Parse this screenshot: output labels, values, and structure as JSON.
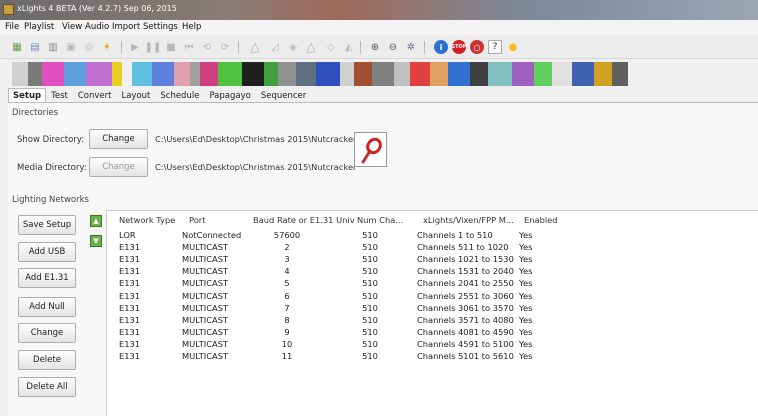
{
  "window": {
    "title": "xLights 4 BETA (Ver 4.2.7) Sep 06, 2015"
  },
  "menu": [
    "File",
    "Playlist",
    "View",
    "Audio",
    "Import",
    "Settings",
    "Help"
  ],
  "toolbar_icons": [
    "new-icon",
    "save-icon",
    "open-icon",
    "render-icon",
    "undo-icon",
    "refresh-icon",
    "play-icon",
    "pause-icon",
    "stop-icon",
    "first-frame-icon",
    "replay-icon",
    "triangle-icon",
    "ramp-icon",
    "cube-icon",
    "triangle-outline-icon",
    "diamond-icon",
    "zoom-in-icon",
    "zoom-out-icon",
    "settings-icon",
    "info-icon",
    "stop-sign-icon",
    "lights-off-icon",
    "help-icon",
    "bulb-icon"
  ],
  "tabs": [
    "Setup",
    "Test",
    "Convert",
    "Layout",
    "Schedule",
    "Papagayo",
    "Sequencer"
  ],
  "active_tab": "Setup",
  "directories": {
    "section_label": "Directories",
    "show_label": "Show Directory:",
    "show_button": "Change",
    "show_path": "C:\\Users\\Ed\\Desktop\\Christmas 2015\\Nutcracker",
    "media_label": "Media Directory:",
    "media_button": "Change",
    "media_path": "C:\\Users\\Ed\\Desktop\\Christmas 2015\\Nutcracker"
  },
  "networks": {
    "section_label": "Lighting Networks",
    "buttons": [
      "Save Setup",
      "Add USB",
      "Add E1.31",
      "Add Null",
      "Change",
      "Delete",
      "Delete All"
    ],
    "columns": [
      "Network Type",
      "Port",
      "Baud Rate or E1.31 Univ",
      "Num Cha...",
      "xLights/Vixen/FPP M...",
      "Enabled"
    ],
    "rows": [
      [
        "LOR",
        "NotConnected",
        "57600",
        "510",
        "Channels 1 to 510",
        "Yes"
      ],
      [
        "E131",
        "MULTICAST",
        "2",
        "510",
        "Channels 511 to 1020",
        "Yes"
      ],
      [
        "E131",
        "MULTICAST",
        "3",
        "510",
        "Channels 1021 to 1530",
        "Yes"
      ],
      [
        "E131",
        "MULTICAST",
        "4",
        "510",
        "Channels 1531 to 2040",
        "Yes"
      ],
      [
        "E131",
        "MULTICAST",
        "5",
        "510",
        "Channels 2041 to 2550",
        "Yes"
      ],
      [
        "E131",
        "MULTICAST",
        "6",
        "510",
        "Channels 2551 to 3060",
        "Yes"
      ],
      [
        "E131",
        "MULTICAST",
        "7",
        "510",
        "Channels 3061 to 3570",
        "Yes"
      ],
      [
        "E131",
        "MULTICAST",
        "8",
        "510",
        "Channels 3571 to 4080",
        "Yes"
      ],
      [
        "E131",
        "MULTICAST",
        "9",
        "510",
        "Channels 4081 to 4590",
        "Yes"
      ],
      [
        "E131",
        "MULTICAST",
        "10",
        "510",
        "Channels 4591 to 5100",
        "Yes"
      ],
      [
        "E131",
        "MULTICAST",
        "11",
        "510",
        "Channels 5101 to 5610",
        "Yes"
      ]
    ]
  },
  "effects_colors": [
    "#d0d0d0",
    "#7a7a7a",
    "#e050c0",
    "#60a0e0",
    "#c070d0",
    "#e8d020",
    "#f0f0f0",
    "#60c0e0",
    "#6080e0",
    "#e0a0b0",
    "#a0a0a0",
    "#d04080",
    "#50c040",
    "#202020",
    "#40a040",
    "#909090",
    "#607080",
    "#3050c0",
    "#d0d0d0",
    "#a05030",
    "#808080",
    "#c0c0c0",
    "#e04040",
    "#e0a060",
    "#3070d0",
    "#404040",
    "#80c0c0",
    "#a060c0",
    "#60d060",
    "#e0e0e0",
    "#4060b0",
    "#d0a020",
    "#606060"
  ]
}
